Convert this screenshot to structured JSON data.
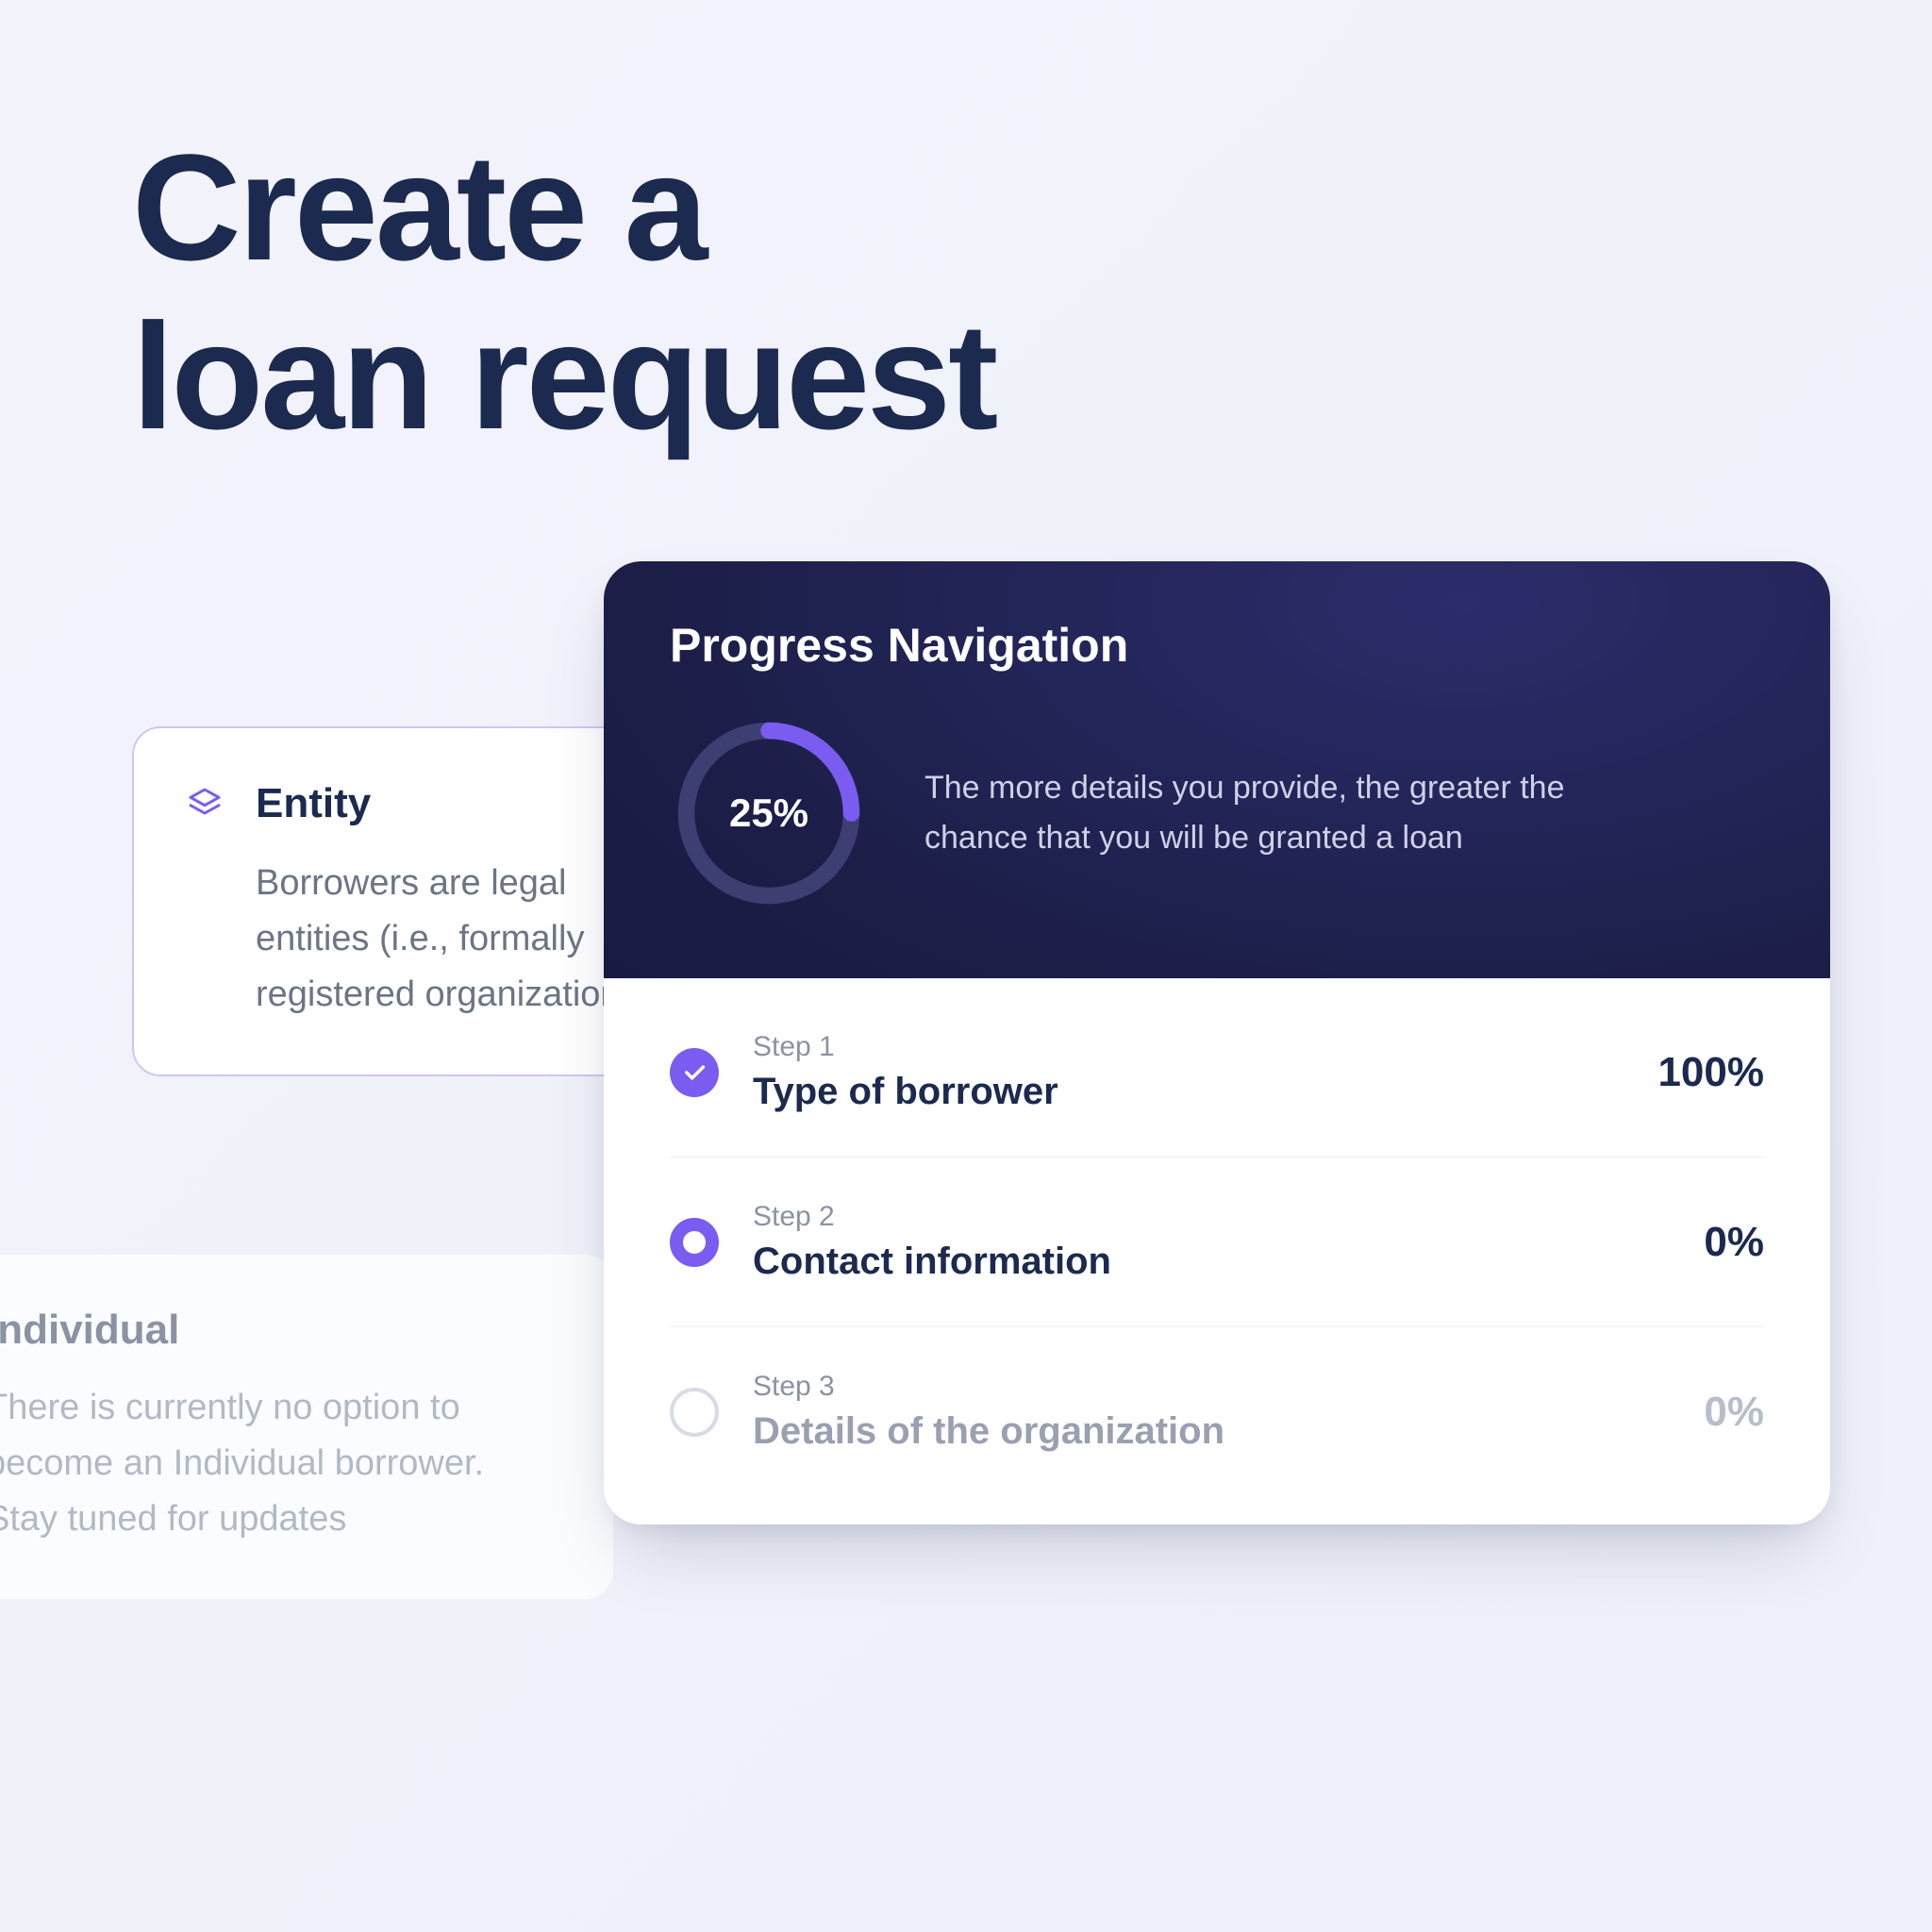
{
  "title": "Create a\nloan request",
  "entity": {
    "heading": "Entity",
    "body": "Borrowers are legal entities (i.e., formally registered organizations)"
  },
  "individual": {
    "heading": "Individual",
    "body": "There is currently no option to become an Individual borrower. Stay tuned for updates"
  },
  "progress": {
    "heading": "Progress Navigation",
    "percent": 25,
    "percent_label": "25%",
    "description": "The more details you provide, the greater the chance that you will be granted a loan",
    "steps": [
      {
        "label": "Step 1",
        "title": "Type of borrower",
        "percent_label": "100%",
        "state": "done"
      },
      {
        "label": "Step 2",
        "title": "Contact information",
        "percent_label": "0%",
        "state": "active"
      },
      {
        "label": "Step 3",
        "title": "Details of the organization",
        "percent_label": "0%",
        "state": "idle"
      }
    ]
  },
  "colors": {
    "accent": "#7a5cf0",
    "heading": "#1b2a4e"
  }
}
